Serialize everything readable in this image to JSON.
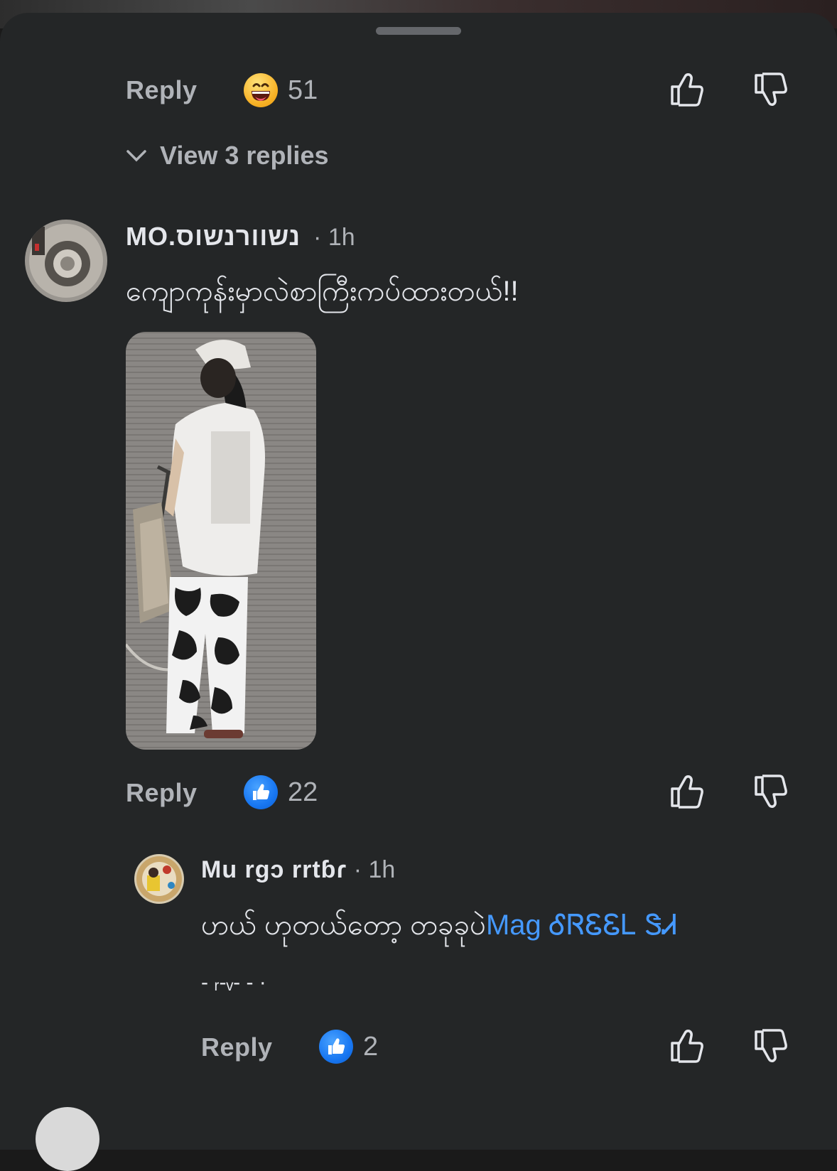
{
  "colors": {
    "sheet_bg": "#242627",
    "text": "#e4e6eb",
    "muted": "#b0b3b8",
    "link": "#4599ff",
    "like_blue": "#1877f2"
  },
  "thread_prev": {
    "reply_label": "Reply",
    "reaction_icon": "haha-emoji",
    "reaction_count": "51",
    "view_replies": "View 3 replies"
  },
  "comment": {
    "author": "MO.נשוורנשוס",
    "time": "· 1h",
    "text": "ကျောကုန်းမှာလဲစာကြီးကပ်ထားတယ်!!",
    "reply_label": "Reply",
    "reaction_icon": "like-thumb",
    "reaction_count": "22"
  },
  "reply": {
    "author": "Mu rgɔ rrtɓɾ",
    "time": "· 1h",
    "text_before": "ဟယ် ဟုတယ်တော့ တခုခုပဲ",
    "mention": "Mag ᎴᏒᏋᏋᏞ ᏕᏗ",
    "text_after": "- ᵣ‐ᵥ‐ - ·",
    "reply_label": "Reply",
    "reaction_icon": "like-thumb",
    "reaction_count": "2"
  }
}
